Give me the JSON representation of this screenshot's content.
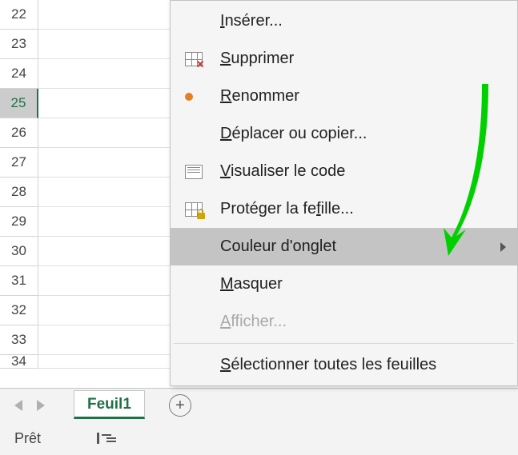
{
  "rows": [
    "22",
    "23",
    "24",
    "25",
    "26",
    "27",
    "28",
    "29",
    "30",
    "31",
    "32",
    "33",
    "34"
  ],
  "active_row_index": 3,
  "sheet_tab": {
    "label": "Feuil1"
  },
  "status": {
    "ready": "Prêt"
  },
  "menu": {
    "insert": "Insérer...",
    "delete": "Supprimer",
    "rename": "Renommer",
    "move_copy": "Déplacer ou copier...",
    "view_code": "Visualiser le code",
    "protect": "Protéger la feuille...",
    "tab_color": "Couleur d'onglet",
    "hide": "Masquer",
    "unhide": "Afficher...",
    "select_all": "Sélectionner toutes les feuilles"
  }
}
